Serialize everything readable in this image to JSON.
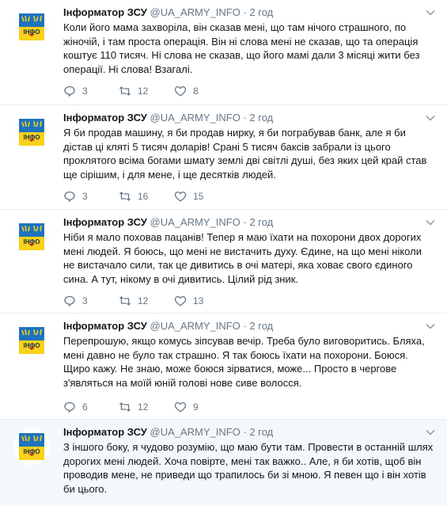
{
  "tweets": [
    {
      "name": "Інформатор ЗСУ",
      "handle": "@UA_ARMY_INFO",
      "dot": "·",
      "time": "2 год",
      "text": "Коли його мама захворіла, він сказав мені, що там нічого страшного, по жіночій, і там проста операція. Він ні слова мені не сказав, що та операція коштує 110 тисяч. Ні слова не сказав, що його мамі дали 3 місяці жити без операції. Ні слова! Взагалі.",
      "replies": "3",
      "retweets": "12",
      "likes": "8"
    },
    {
      "name": "Інформатор ЗСУ",
      "handle": "@UA_ARMY_INFO",
      "dot": "·",
      "time": "2 год",
      "text": "Я би продав машину, я би продав нирку, я би пограбував банк, але я би дістав ці кляті 5 тисяч доларів! Срані 5 тисяч баксів забрали із цього проклятого всіма богами шмату землі дві світлі душі, без яких цей край став ще сірішим, і для мене, і ще десятків людей.",
      "replies": "3",
      "retweets": "16",
      "likes": "15"
    },
    {
      "name": "Інформатор ЗСУ",
      "handle": "@UA_ARMY_INFO",
      "dot": "·",
      "time": "2 год",
      "text": "Ніби я мало поховав пацанів! Тепер я маю їхати на похорони двох дорогих мені людей. Я боюсь, що мені не вистачить духу. Єдине, на що мені ніколи не вистачало сили, так це дивитись в очі матері, яка ховає свого єдиного сина. А тут, нікому в очі дивитись. Цілий рід зник.",
      "replies": "3",
      "retweets": "12",
      "likes": "13"
    },
    {
      "name": "Інформатор ЗСУ",
      "handle": "@UA_ARMY_INFO",
      "dot": "·",
      "time": "2 год",
      "text": "Перепрошую, якщо комусь зіпсував вечір. Треба було виговоритись. Бляха, мені давно не було так страшно. Я так боюсь їхати на похорони. Боюся. Щиро кажу. Не знаю, може боюся зірватися, може... Просто в чергове з'являться на моїй юній голові нове сиве волосся.",
      "replies": "6",
      "retweets": "12",
      "likes": "9"
    },
    {
      "name": "Інформатор ЗСУ",
      "handle": "@UA_ARMY_INFO",
      "dot": "·",
      "time": "2 год",
      "text": "З іншого боку, я чудово розумію, що маю бути там. Провести в останній шлях дорогих мені людей. Хоча повірте, мені так важко.. Але, я би хотів, щоб він проводив мене, не приведи що трапилось би зі мною. Я певен що і він хотів би цього."
    }
  ],
  "avatar": {
    "label": "ІНФО",
    "flag_blue": "#1e73be",
    "flag_yellow": "#f7d21a",
    "mark_red": "#c0262d"
  },
  "icons": {
    "reply": "reply-icon",
    "retweet": "retweet-icon",
    "like": "heart-icon",
    "menu": "chevron-down-icon"
  }
}
